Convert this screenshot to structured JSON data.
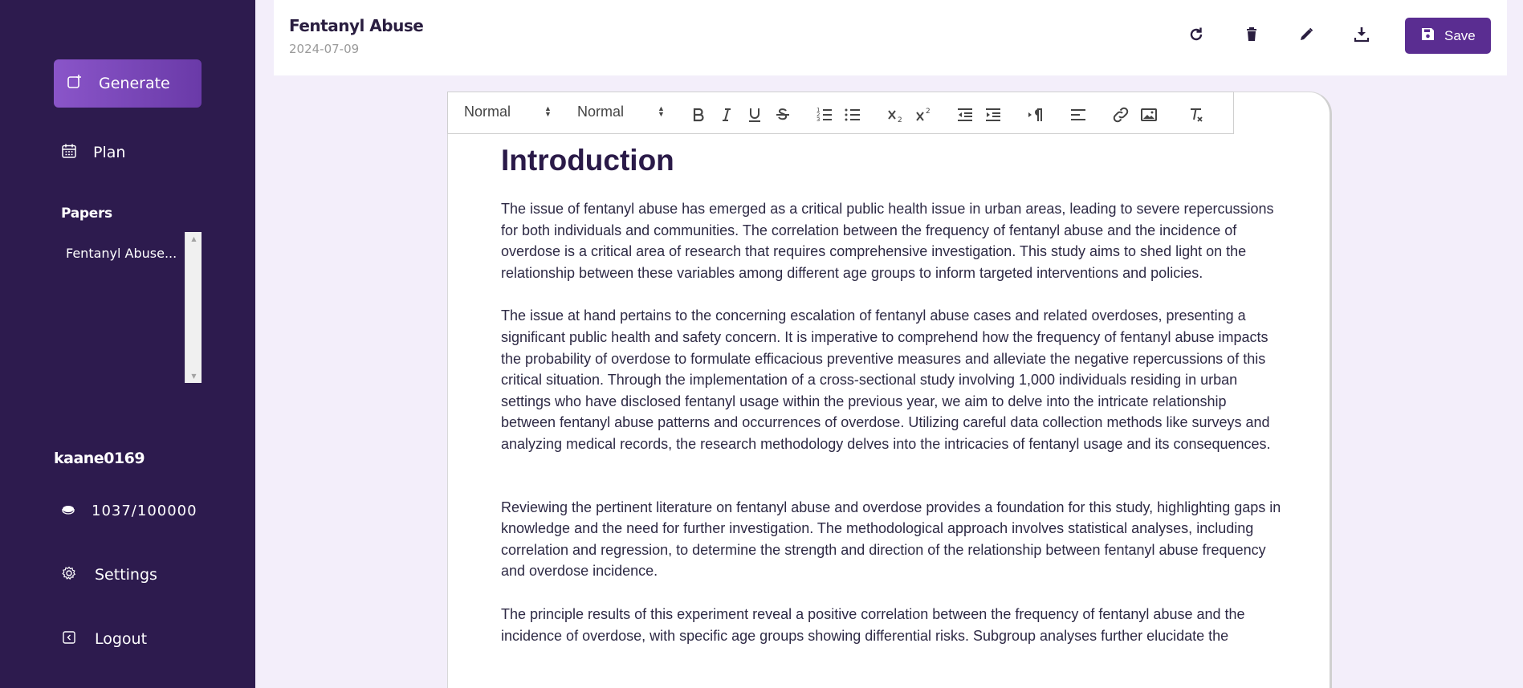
{
  "sidebar": {
    "generate_label": "Generate",
    "plan_label": "Plan",
    "papers_heading": "Papers",
    "papers": [
      {
        "label": "Fentanyl Abuse..."
      }
    ],
    "username": "kaane0169",
    "credits": "1037/100000",
    "settings_label": "Settings",
    "logout_label": "Logout"
  },
  "header": {
    "title": "Fentanyl Abuse",
    "date": "2024-07-09",
    "save_label": "Save"
  },
  "toolbar": {
    "heading_select": "Normal",
    "size_select": "Normal"
  },
  "document": {
    "heading": "Introduction",
    "paragraphs": [
      "The issue of fentanyl abuse has emerged as a critical public health issue in urban areas, leading to severe repercussions for both individuals and communities. The correlation between the frequency of fentanyl abuse and the incidence of overdose is a critical area of research that requires comprehensive investigation. This study aims to shed light on the relationship between these variables among different age groups to inform targeted interventions and policies.",
      "The issue at hand pertains to the concerning escalation of fentanyl abuse cases and related overdoses, presenting a significant public health and safety concern. It is imperative to comprehend how the frequency of fentanyl abuse impacts the probability of overdose to formulate efficacious preventive measures and alleviate the negative repercussions of this critical situation. Through the implementation of a cross-sectional study involving 1,000 individuals residing in urban settings who have disclosed fentanyl usage within the previous year, we aim to delve into the intricate relationship between fentanyl abuse patterns and occurrences of overdose. Utilizing careful data collection methods like surveys and analyzing medical records, the research methodology delves into the intricacies of fentanyl usage and its consequences.",
      "Reviewing the pertinent literature on fentanyl abuse and overdose provides a foundation for this study, highlighting gaps in knowledge and the need for further investigation. The methodological approach involves statistical analyses, including correlation and regression, to determine the strength and direction of the relationship between fentanyl abuse frequency and overdose incidence.",
      "The principle results of this experiment reveal a positive correlation between the frequency of fentanyl abuse and the incidence of overdose, with specific age groups showing differential risks. Subgroup analyses further elucidate the"
    ]
  },
  "colors": {
    "sidebar_bg": "#2d1b4e",
    "accent": "#5a2d91",
    "page_bg": "#f3eefa"
  }
}
